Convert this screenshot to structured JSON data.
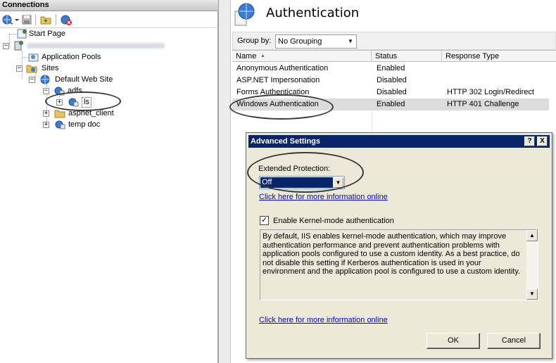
{
  "connections": {
    "header": "Connections",
    "tree": [
      {
        "label": "Start Page"
      },
      {
        "label": ""
      },
      {
        "label": "Application Pools"
      },
      {
        "label": "Sites"
      },
      {
        "label": "Default Web Site"
      },
      {
        "label": "adfs"
      },
      {
        "label": "ls"
      },
      {
        "label": "aspnet_client"
      },
      {
        "label": "temp doc"
      }
    ]
  },
  "main": {
    "title": "Authentication",
    "group_by_label": "Group by:",
    "group_by_value": "No Grouping",
    "columns": [
      "Name",
      "Status",
      "Response Type"
    ],
    "rows": [
      {
        "name": "Anonymous Authentication",
        "status": "Enabled",
        "response": ""
      },
      {
        "name": "ASP.NET Impersonation",
        "status": "Disabled",
        "response": ""
      },
      {
        "name": "Forms Authentication",
        "status": "Disabled",
        "response": "HTTP 302 Login/Redirect"
      },
      {
        "name": "Windows Authentication",
        "status": "Enabled",
        "response": "HTTP 401 Challenge"
      }
    ]
  },
  "dialog": {
    "title": "Advanced Settings",
    "help_btn": "?",
    "close_btn": "X",
    "extended_protection_label": "Extended Protection:",
    "extended_protection_value": "Off",
    "more_info_link_1": "Click here for more information online",
    "kernel_mode_checked": true,
    "kernel_mode_label": "Enable Kernel-mode authentication",
    "description": "By default, IIS enables kernel-mode authentication, which may improve authentication performance and prevent authentication problems with application pools configured to use a custom identity. As a best practice, do not disable this setting if Kerberos authentication is used in your environment and the application pool is configured to use a custom identity.",
    "more_info_link_2": "Click here for more information online",
    "ok_label": "OK",
    "cancel_label": "Cancel"
  },
  "colors": {
    "dialog_title_bg": "#0a246a",
    "selected_value_bg": "#0a246a",
    "link": "#0000ee",
    "dialog_bg": "#ece9d8"
  }
}
